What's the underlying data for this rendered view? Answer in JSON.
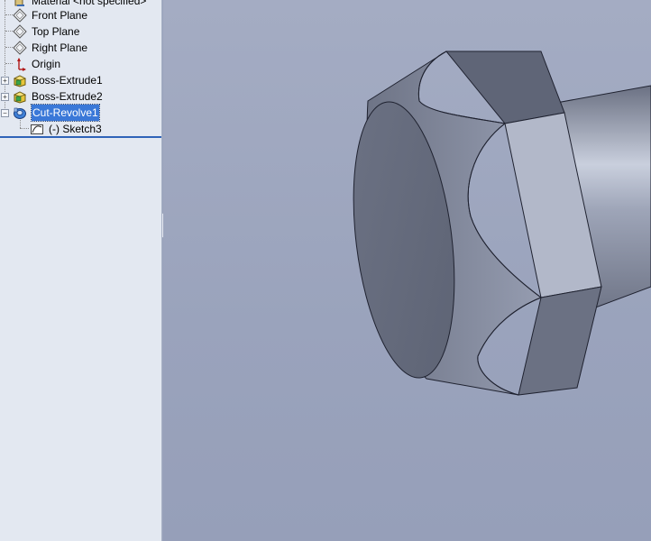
{
  "feature_tree": {
    "items": [
      {
        "label": "Material <not specified>",
        "icon": "material-icon"
      },
      {
        "label": "Front Plane",
        "icon": "plane-icon"
      },
      {
        "label": "Top Plane",
        "icon": "plane-icon"
      },
      {
        "label": "Right Plane",
        "icon": "plane-icon"
      },
      {
        "label": "Origin",
        "icon": "origin-icon"
      },
      {
        "label": "Boss-Extrude1",
        "icon": "boss-extrude-icon"
      },
      {
        "label": "Boss-Extrude2",
        "icon": "boss-extrude-icon"
      },
      {
        "label": "Cut-Revolve1",
        "icon": "cut-revolve-icon",
        "selected": true
      },
      {
        "label": "(-) Sketch3",
        "icon": "sketch-icon"
      }
    ]
  },
  "colors": {
    "tree_background": "#e3e8f1",
    "selection": "#3a78d8",
    "viewport_background": "#9aa3bc",
    "separator": "#2f63b8"
  }
}
